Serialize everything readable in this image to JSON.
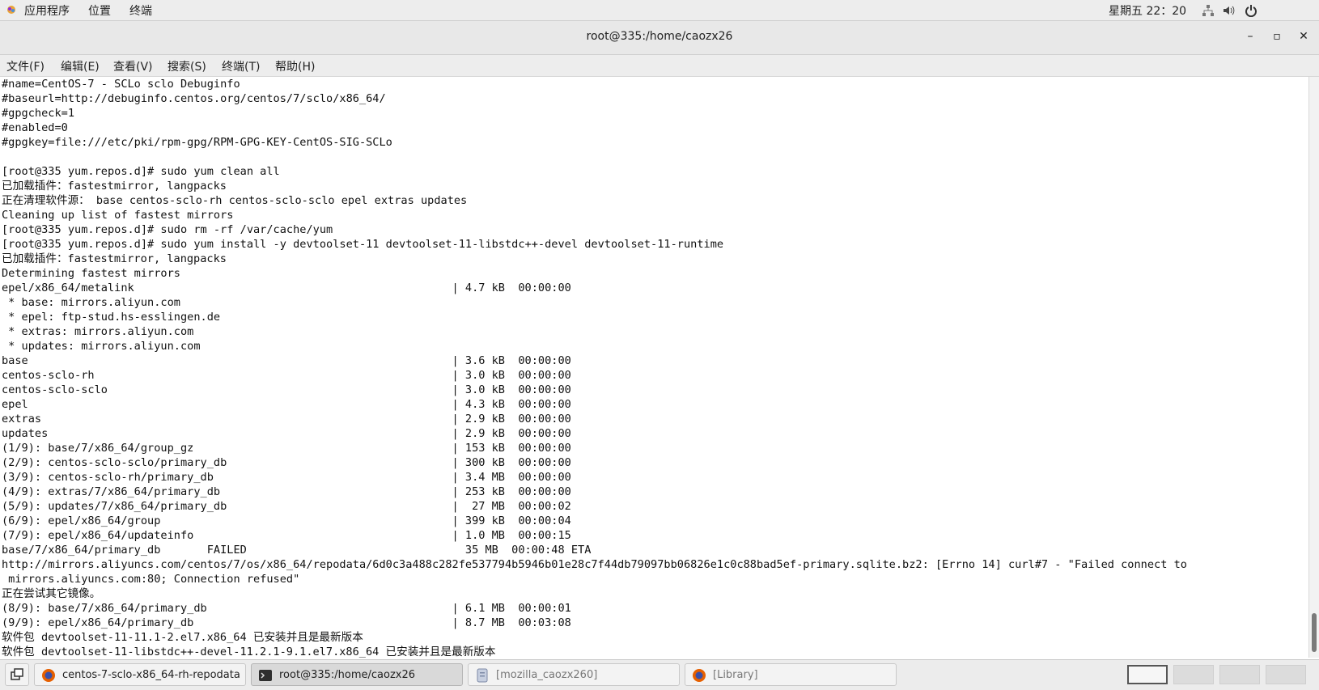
{
  "topbar": {
    "apps": "应用程序",
    "places": "位置",
    "terminal": "终端",
    "clock": "星期五 22：20"
  },
  "window": {
    "title": "root@335:/home/caozx26",
    "minimize": "–",
    "maximize": "▫",
    "close": "✕"
  },
  "menubar": [
    "文件(F)",
    "编辑(E)",
    "查看(V)",
    "搜索(S)",
    "终端(T)",
    "帮助(H)"
  ],
  "terminal": {
    "lines": [
      "#name=CentOS-7 - SCLo sclo Debuginfo",
      "#baseurl=http://debuginfo.centos.org/centos/7/sclo/x86_64/",
      "#gpgcheck=1",
      "#enabled=0",
      "#gpgkey=file:///etc/pki/rpm-gpg/RPM-GPG-KEY-CentOS-SIG-SCLo",
      "",
      "[root@335 yum.repos.d]# sudo yum clean all",
      "已加载插件：fastestmirror, langpacks",
      "正在清理软件源： base centos-sclo-rh centos-sclo-sclo epel extras updates",
      "Cleaning up list of fastest mirrors",
      "[root@335 yum.repos.d]# sudo rm -rf /var/cache/yum",
      "[root@335 yum.repos.d]# sudo yum install -y devtoolset-11 devtoolset-11-libstdc++-devel devtoolset-11-runtime",
      "已加载插件：fastestmirror, langpacks",
      "Determining fastest mirrors",
      "epel/x86_64/metalink                                                | 4.7 kB  00:00:00",
      " * base: mirrors.aliyun.com",
      " * epel: ftp-stud.hs-esslingen.de",
      " * extras: mirrors.aliyun.com",
      " * updates: mirrors.aliyun.com",
      "base                                                                | 3.6 kB  00:00:00",
      "centos-sclo-rh                                                      | 3.0 kB  00:00:00",
      "centos-sclo-sclo                                                    | 3.0 kB  00:00:00",
      "epel                                                                | 4.3 kB  00:00:00",
      "extras                                                              | 2.9 kB  00:00:00",
      "updates                                                             | 2.9 kB  00:00:00",
      "(1/9): base/7/x86_64/group_gz                                       | 153 kB  00:00:00",
      "(2/9): centos-sclo-sclo/primary_db                                  | 300 kB  00:00:00",
      "(3/9): centos-sclo-rh/primary_db                                    | 3.4 MB  00:00:00",
      "(4/9): extras/7/x86_64/primary_db                                   | 253 kB  00:00:00",
      "(5/9): updates/7/x86_64/primary_db                                  |  27 MB  00:00:02",
      "(6/9): epel/x86_64/group                                            | 399 kB  00:00:04",
      "(7/9): epel/x86_64/updateinfo                                       | 1.0 MB  00:00:15",
      "base/7/x86_64/primary_db       FAILED                                 35 MB  00:00:48 ETA",
      "http://mirrors.aliyuncs.com/centos/7/os/x86_64/repodata/6d0c3a488c282fe537794b5946b01e28c7f44db79097bb06826e1c0c88bad5ef-primary.sqlite.bz2: [Errno 14] curl#7 - \"Failed connect to",
      " mirrors.aliyuncs.com:80; Connection refused\"",
      "正在尝试其它镜像。",
      "(8/9): base/7/x86_64/primary_db                                     | 6.1 MB  00:00:01",
      "(9/9): epel/x86_64/primary_db                                       | 8.7 MB  00:03:08",
      "软件包 devtoolset-11-11.1-2.el7.x86_64 已安装并且是最新版本",
      "软件包 devtoolset-11-libstdc++-devel-11.2.1-9.1.el7.x86_64 已安装并且是最新版本"
    ]
  },
  "taskbar": {
    "items": [
      {
        "label": "centos-7-sclo-x86_64-rh-repodata...",
        "icon": "firefox-icon"
      },
      {
        "label": "root@335:/home/caozx26",
        "icon": "terminal-icon"
      },
      {
        "label": "[mozilla_caozx260]",
        "icon": "file-manager-icon"
      },
      {
        "label": "[Library]",
        "icon": "firefox-icon"
      }
    ]
  },
  "colors": {
    "firefox": "#e66000",
    "terminal_bg": "#ffffff",
    "panel": "#ededed"
  }
}
